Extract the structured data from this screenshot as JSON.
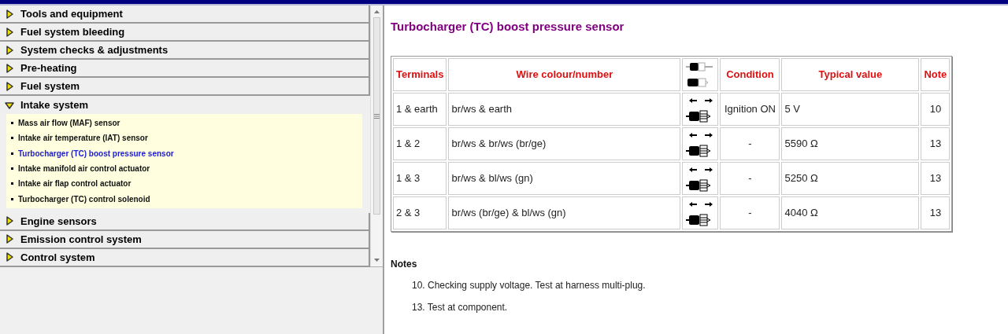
{
  "sidebar": {
    "sections": [
      {
        "label": "Tools and equipment",
        "expanded": false
      },
      {
        "label": "Fuel system bleeding",
        "expanded": false
      },
      {
        "label": "System checks & adjustments",
        "expanded": false
      },
      {
        "label": "Pre-heating",
        "expanded": false
      },
      {
        "label": "Fuel system",
        "expanded": false
      },
      {
        "label": "Intake system",
        "expanded": true,
        "items": [
          {
            "label": "Mass air flow (MAF) sensor",
            "selected": false
          },
          {
            "label": "Intake air temperature (IAT) sensor",
            "selected": false
          },
          {
            "label": "Turbocharger (TC) boost pressure sensor",
            "selected": true
          },
          {
            "label": "Intake manifold air control actuator",
            "selected": false
          },
          {
            "label": "Intake air flap control actuator",
            "selected": false
          },
          {
            "label": "Turbocharger (TC) control solenoid",
            "selected": false
          }
        ]
      },
      {
        "label": "Engine sensors",
        "expanded": false
      },
      {
        "label": "Emission control system",
        "expanded": false
      },
      {
        "label": "Control system",
        "expanded": false
      }
    ]
  },
  "content": {
    "title": "Turbocharger (TC) boost pressure sensor",
    "table": {
      "columns": [
        {
          "kind": "text",
          "label": "Terminals"
        },
        {
          "kind": "text",
          "label": "Wire colour/number"
        },
        {
          "kind": "icon"
        },
        {
          "kind": "text",
          "label": "Condition"
        },
        {
          "kind": "text",
          "label": "Typical value"
        },
        {
          "kind": "text",
          "label": "Note"
        }
      ],
      "rows": [
        [
          "1 & earth",
          "br/ws & earth",
          null,
          "Ignition ON",
          "5 V",
          "10"
        ],
        [
          "1 & 2",
          "br/ws & br/ws (br/ge)",
          null,
          "-",
          "5590 Ω",
          "13"
        ],
        [
          "1 & 3",
          "br/ws & bl/ws (gn)",
          null,
          "-",
          "5250 Ω",
          "13"
        ],
        [
          "2 & 3",
          "br/ws (br/ge) & bl/ws (gn)",
          null,
          "-",
          "4040 Ω",
          "13"
        ]
      ]
    },
    "notes": {
      "heading": "Notes",
      "items": [
        "10. Checking supply voltage. Test at harness multi-plug.",
        "13. Test at component."
      ]
    }
  }
}
